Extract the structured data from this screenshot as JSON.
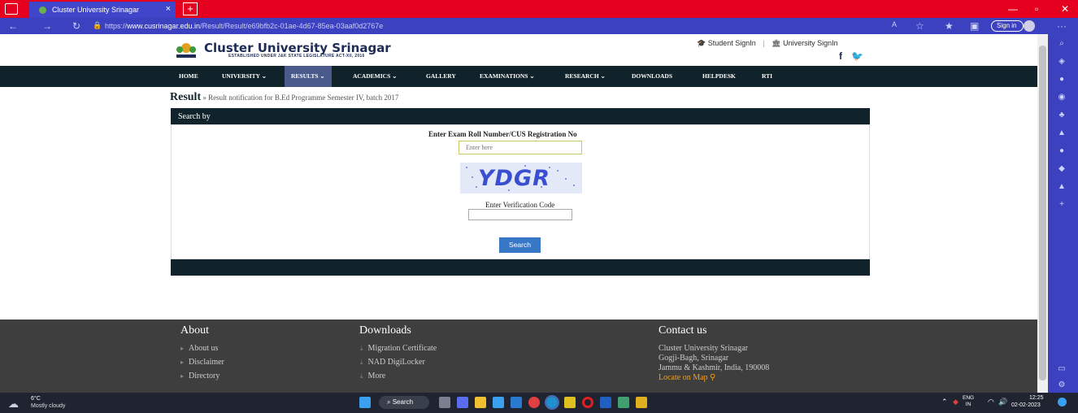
{
  "browser": {
    "tab_title": "Cluster University Srinagar",
    "tab_close": "×",
    "new_tab": "+",
    "url_prefix": "https://",
    "url_domain": "www.cusrinagar.edu.in",
    "url_path": "/Result/Result/e69bfb2c-01ae-4d67-85ea-03aaf0d2767e",
    "sign_in": "Sign in",
    "colors": {
      "tabbar": "#e5001f",
      "toolbar": "#3b41bf"
    }
  },
  "site": {
    "name": "Cluster University Srinagar",
    "subtitle": "ESTABLISHED UNDER J&K STATE LEGISLATURE ACT-XII, 2016",
    "student_signin": "Student SignIn",
    "university_signin": "University SignIn",
    "nav": [
      {
        "label": "HOME"
      },
      {
        "label": "UNIVERSITY ⌄"
      },
      {
        "label": "RESULTS ⌄",
        "active": true
      },
      {
        "label": "ACADEMICS ⌄"
      },
      {
        "label": "GALLERY"
      },
      {
        "label": "EXAMINATIONS ⌄"
      },
      {
        "label": "RESEARCH ⌄"
      },
      {
        "label": "DOWNLOADS"
      },
      {
        "label": "HELPDESK"
      },
      {
        "label": "RTI"
      }
    ]
  },
  "breadcrumb": {
    "title": "Result",
    "sep": "»",
    "text": "Result notification for B.Ed Programme Semester IV, batch 2017"
  },
  "form": {
    "header": "Search by",
    "roll_label": "Enter Exam Roll Number/CUS Registration No",
    "roll_placeholder": "Enter here",
    "captcha_text": "YDGR",
    "verification_label": "Enter Verification Code",
    "search_button": "Search"
  },
  "footer": {
    "about": {
      "title": "About",
      "links": [
        "About us",
        "Disclaimer",
        "Directory"
      ]
    },
    "downloads": {
      "title": "Downloads",
      "links": [
        "Migration Certificate",
        "NAD DigiLocker",
        "More"
      ]
    },
    "contact": {
      "title": "Contact us",
      "lines": [
        "Cluster University Srinagar",
        "Gogji-Bagh, Srinagar",
        "Jammu & Kashmir, India, 190008"
      ],
      "map_link": "Locate on Map"
    }
  },
  "taskbar": {
    "temp": "6°C",
    "weather": "Mostly cloudy",
    "search": "Search",
    "lang_top": "ENG",
    "lang_bottom": "IN",
    "time": "12:25",
    "date": "02-02-2023"
  }
}
